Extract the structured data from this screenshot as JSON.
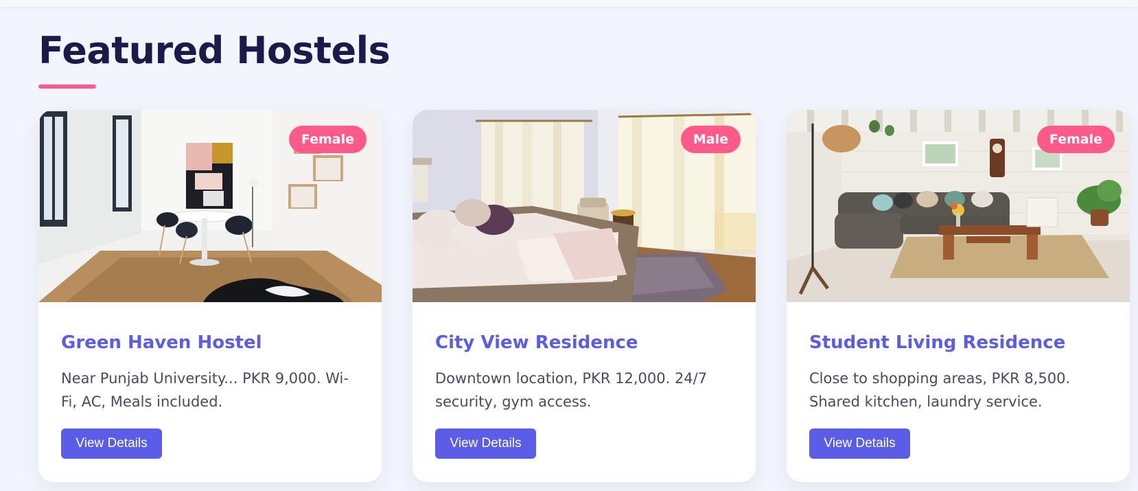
{
  "colors": {
    "accent": "#5b5ce8",
    "badge": "#ff5a8a",
    "heading": "#1b1a4a"
  },
  "section": {
    "title": "Featured Hostels"
  },
  "hostels": [
    {
      "name": "Green Haven Hostel",
      "gender": "Female",
      "description": "Near Punjab University... PKR 9,000. Wi-Fi, AC, Meals included.",
      "button": "View Details",
      "image": "dining-room-photo"
    },
    {
      "name": "City View Residence",
      "gender": "Male",
      "description": "Downtown location, PKR 12,000. 24/7 security, gym access.",
      "button": "View Details",
      "image": "bedroom-photo"
    },
    {
      "name": "Student Living Residence",
      "gender": "Female",
      "description": "Close to shopping areas, PKR 8,500. Shared kitchen, laundry service.",
      "button": "View Details",
      "image": "living-room-photo"
    }
  ]
}
